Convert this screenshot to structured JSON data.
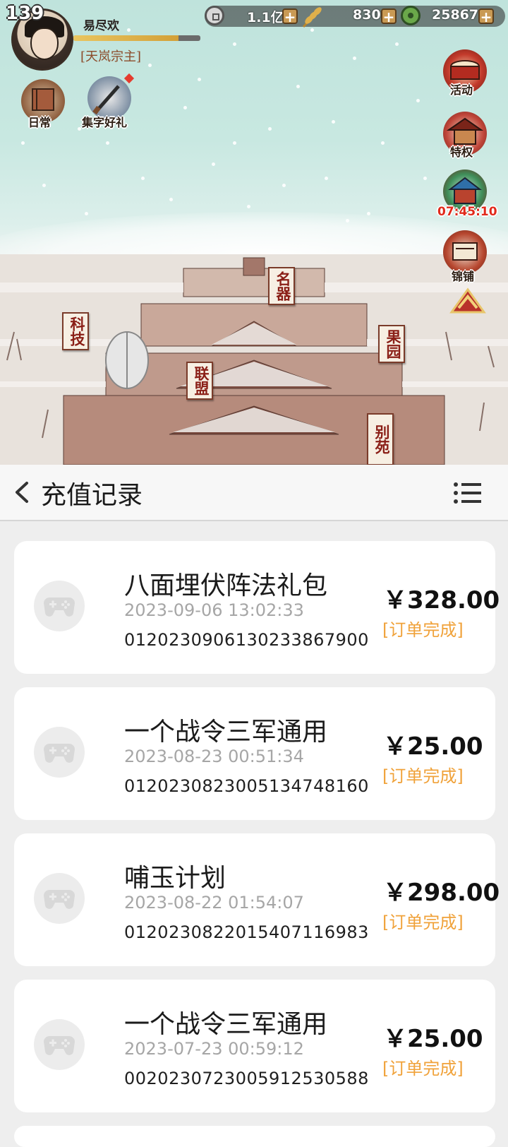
{
  "game": {
    "level": "139",
    "player_name": "易尽欢",
    "player_title": "[天岚宗主]",
    "exp_progress": 0.83,
    "resources": [
      {
        "name": "coin-icon",
        "value": "1.1亿"
      },
      {
        "name": "grain-icon",
        "value": "830"
      },
      {
        "name": "jade-icon",
        "value": "25867"
      }
    ],
    "left_buttons": [
      {
        "icon": "book-icon",
        "label": "日常"
      },
      {
        "icon": "brush-icon",
        "label": "集字好礼"
      }
    ],
    "right_buttons": [
      {
        "icon": "drum-icon",
        "label": "活动"
      },
      {
        "icon": "pavilion-icon",
        "label": "特权"
      },
      {
        "icon": "shop-icon",
        "label": "07:45:10"
      },
      {
        "icon": "scroll-icon",
        "label": "锦铺"
      }
    ],
    "map_signs": [
      "名器",
      "科技",
      "果园",
      "联盟",
      "别苑"
    ]
  },
  "header": {
    "title": "充值记录"
  },
  "records": [
    {
      "name": "八面埋伏阵法礼包",
      "date": "2023-09-06 13:02:33",
      "order": "0120230906130233867900",
      "price": "￥328.00",
      "status": "[订单完成]"
    },
    {
      "name": "一个战令三军通用",
      "date": "2023-08-23 00:51:34",
      "order": "0120230823005134748160",
      "price": "￥25.00",
      "status": "[订单完成]"
    },
    {
      "name": "哺玉计划",
      "date": "2023-08-22 01:54:07",
      "order": "0120230822015407116983",
      "price": "￥298.00",
      "status": "[订单完成]"
    },
    {
      "name": "一个战令三军通用",
      "date": "2023-07-23 00:59:12",
      "order": "0020230723005912530588",
      "price": "￥25.00",
      "status": "[订单完成]"
    }
  ]
}
